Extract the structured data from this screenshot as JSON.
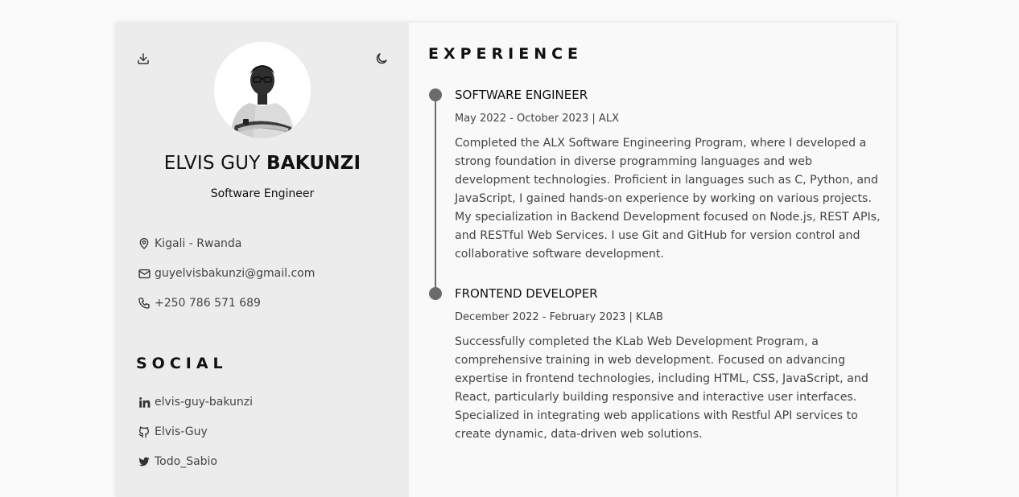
{
  "profile": {
    "first_names": "ELVIS GUY",
    "last_name": "BAKUNZI",
    "role": "Software Engineer",
    "avatar_alt": "Profile photo"
  },
  "toolbar": {
    "download_icon": "download-icon",
    "theme_icon": "moon-icon"
  },
  "contact": {
    "location": "Kigali - Rwanda",
    "email": "guyelvisbakunzi@gmail.com",
    "phone": "+250 786 571 689"
  },
  "social": {
    "title": "SOCIAL",
    "linkedin": "elvis-guy-bakunzi",
    "github": "Elvis-Guy",
    "twitter": "Todo_Sabio"
  },
  "experience": {
    "title": "EXPERIENCE",
    "items": [
      {
        "title": "SOFTWARE ENGINEER",
        "meta": "May 2022 - October 2023 | ALX",
        "description": "Completed the ALX Software Engineering Program, where I developed a strong foundation in diverse programming languages and web development technologies. Proficient in languages such as C, Python, and JavaScript, I gained hands-on experience by working on various projects. My specialization in Backend Development focused on Node.js, REST APIs, and RESTful Web Services. I use Git and GitHub for version control and collaborative software development."
      },
      {
        "title": "FRONTEND DEVELOPER",
        "meta": "December 2022 - February 2023 | KLAB",
        "description": "Successfully completed the KLab Web Development Program, a comprehensive training in web development. Focused on advancing expertise in frontend technologies, including HTML, CSS, JavaScript, and React, particularly building responsive and interactive user interfaces. Specialized in integrating web applications with Restful API services to create dynamic, data-driven web solutions."
      }
    ]
  },
  "colors": {
    "sidebar_bg": "#ececec",
    "main_bg": "#f9f9f9",
    "timeline": "#6b6b6b",
    "text_dark": "#111111",
    "text_body": "#444444"
  }
}
